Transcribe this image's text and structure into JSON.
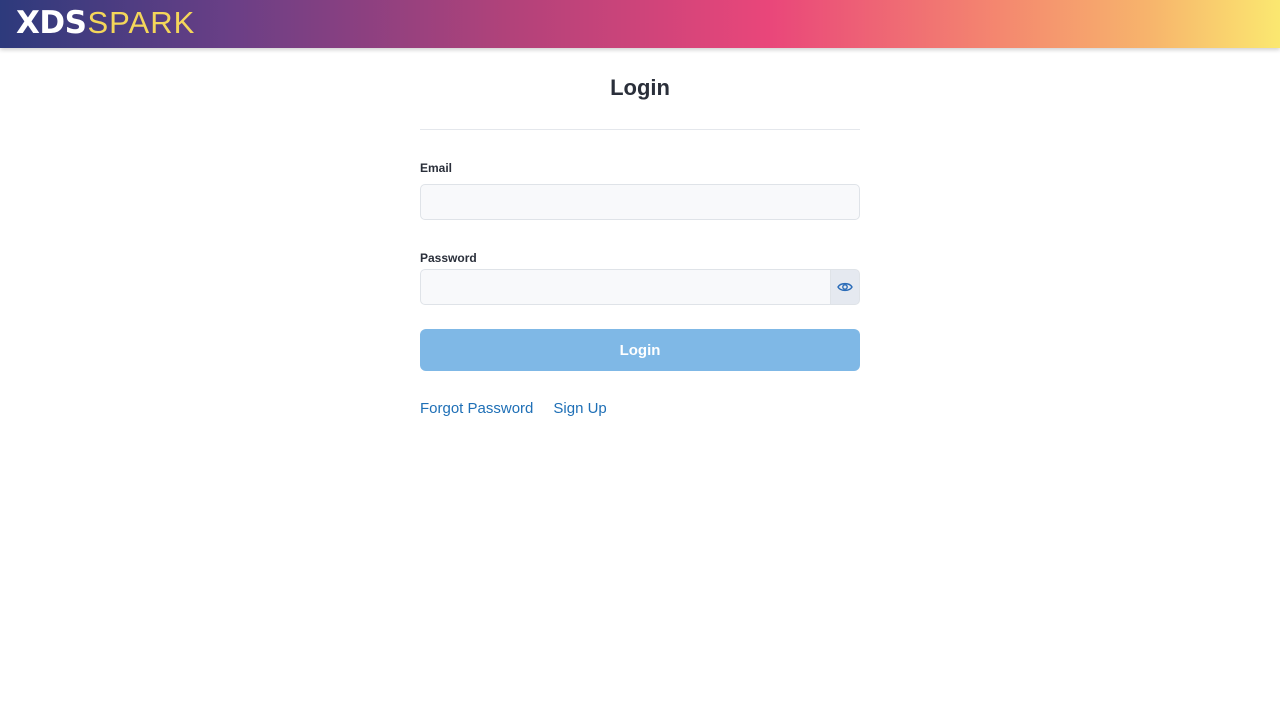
{
  "header": {
    "logo_bold": "XDS",
    "logo_light": "SPARK",
    "gradient_colors": [
      "#2d3a7c",
      "#6a3f86",
      "#b2427a",
      "#e9467a",
      "#f4876f",
      "#f7b56c",
      "#fbe870"
    ]
  },
  "form": {
    "title": "Login",
    "email": {
      "label": "Email",
      "value": "",
      "placeholder": ""
    },
    "password": {
      "label": "Password",
      "value": "",
      "placeholder": "",
      "toggle_icon": "eye-icon"
    },
    "submit_label": "Login",
    "submit_color": "#7fb8e6"
  },
  "links": {
    "forgot_password": "Forgot Password",
    "sign_up": "Sign Up",
    "link_color": "#1e6fb6"
  }
}
